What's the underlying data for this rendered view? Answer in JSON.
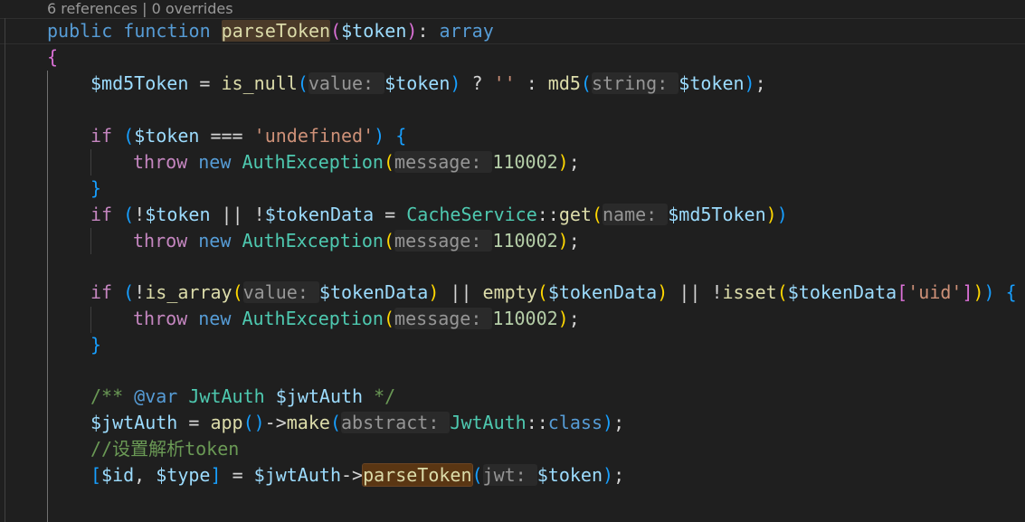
{
  "codelens": {
    "text": "6 references | 0 overrides"
  },
  "line1": {
    "public": "public",
    "function": "function",
    "name": "parseToken",
    "p1": "(",
    "arg": "$token",
    "p2": ")",
    "colon": ": ",
    "type": "array"
  },
  "line2": {
    "brace": "{"
  },
  "line3": {
    "var": "$md5Token",
    "eq": " = ",
    "fn1": "is_null",
    "p1": "(",
    "hint1": "value: ",
    "arg1": "$token",
    "p2": ")",
    "tern": " ? ",
    "str": "''",
    "colon": " : ",
    "fn2": "md5",
    "p3": "(",
    "hint2": "string: ",
    "arg2": "$token",
    "p4": ")",
    "semi": ";"
  },
  "line5": {
    "if": "if",
    "p1": " (",
    "var": "$token",
    "op": " === ",
    "str": "'undefined'",
    "p2": ")",
    "brace": " {"
  },
  "line6": {
    "throw": "throw",
    "new": " new ",
    "cls": "AuthException",
    "p1": "(",
    "hint": "message: ",
    "num": "110002",
    "p2": ")",
    "semi": ";"
  },
  "line7": {
    "brace": "}"
  },
  "line8": {
    "if": "if",
    "p1": " (",
    "not1": "!",
    "var1": "$token",
    "or": " || ",
    "not2": "!",
    "var2": "$tokenData",
    "eq": " = ",
    "cls": "CacheService",
    "dc": "::",
    "fn": "get",
    "p2": "(",
    "hint": "name: ",
    "var3": "$md5Token",
    "p3": ")",
    "p4": ")"
  },
  "line9": {
    "throw": "throw",
    "new": " new ",
    "cls": "AuthException",
    "p1": "(",
    "hint": "message: ",
    "num": "110002",
    "p2": ")",
    "semi": ";"
  },
  "line11": {
    "if": "if",
    "p1": " (",
    "not1": "!",
    "fn1": "is_array",
    "p2": "(",
    "hint": "value: ",
    "var1": "$tokenData",
    "p3": ")",
    "or1": " || ",
    "fn2": "empty",
    "p4": "(",
    "var2": "$tokenData",
    "p5": ")",
    "or2": " || ",
    "not2": "!",
    "fn3": "isset",
    "p6": "(",
    "var3": "$tokenData",
    "b1": "[",
    "str": "'uid'",
    "b2": "]",
    "p7": ")",
    "p8": ")",
    "brace": " {"
  },
  "line12": {
    "throw": "throw",
    "new": " new ",
    "cls": "AuthException",
    "p1": "(",
    "hint": "message: ",
    "num": "110002",
    "p2": ")",
    "semi": ";"
  },
  "line13": {
    "brace": "}"
  },
  "line15": {
    "c1": "/** ",
    "tag": "@var",
    "sp": " ",
    "cls": "JwtAuth",
    "sp2": " ",
    "var": "$jwtAuth",
    "c2": " */"
  },
  "line16": {
    "var": "$jwtAuth",
    "eq": " = ",
    "fn1": "app",
    "p1": "(",
    "p2": ")",
    "arrow": "->",
    "fn2": "make",
    "p3": "(",
    "hint": "abstract: ",
    "cls": "JwtAuth",
    "dc": "::",
    "kw": "class",
    "p4": ")",
    "semi": ";"
  },
  "line17": {
    "comment": "//设置解析token"
  },
  "line18": {
    "b1": "[",
    "var1": "$id",
    "comma": ", ",
    "var2": "$type",
    "b2": "]",
    "eq": " = ",
    "var3": "$jwtAuth",
    "arrow": "->",
    "fn": "parseToken",
    "p1": "(",
    "hint": "jwt: ",
    "var4": "$token",
    "p2": ")",
    "semi": ";"
  }
}
